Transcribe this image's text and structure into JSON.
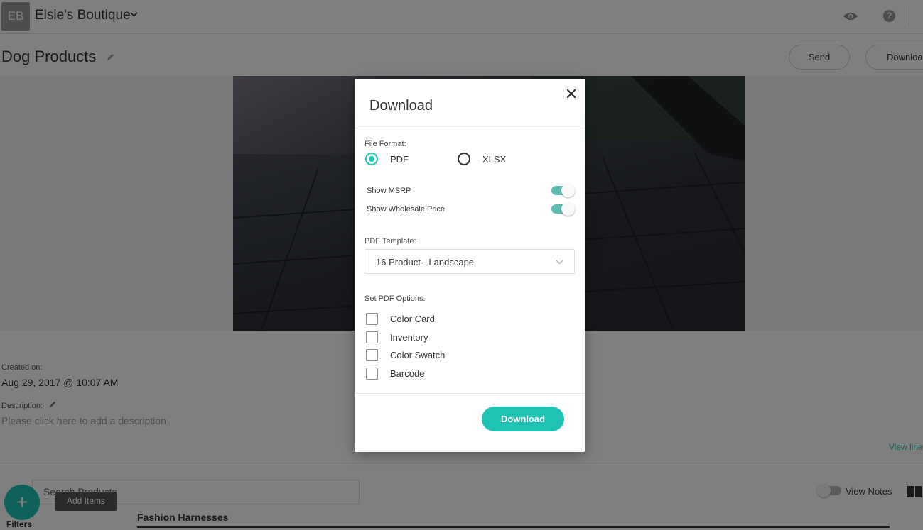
{
  "topbar": {
    "avatar_initials": "EB",
    "store_name": "Elsie's Boutique"
  },
  "page": {
    "title": "Dog Products",
    "send_label": "Send",
    "download_label": "Download"
  },
  "meta": {
    "created_label": "Created on:",
    "created_value": "Aug 29, 2017 @ 10:07 AM",
    "description_label": "Description:",
    "description_placeholder": "Please click here to add a description",
    "view_link": "View line"
  },
  "products": {
    "search_placeholder": "Search Products",
    "add_items_tooltip": "Add Items",
    "add_glyph": "+",
    "filters_label": "Filters",
    "view_notes_label": "View Notes",
    "section_title": "Fashion Harnesses"
  },
  "modal": {
    "title": "Download",
    "file_format_label": "File Format:",
    "formats": [
      {
        "label": "PDF",
        "checked": true
      },
      {
        "label": "XLSX",
        "checked": false
      }
    ],
    "toggles": [
      {
        "label": "Show MSRP",
        "on": true
      },
      {
        "label": "Show Wholesale Price",
        "on": true
      }
    ],
    "template_label": "PDF Template:",
    "template_value": "16 Product - Landscape",
    "options_label": "Set PDF Options:",
    "options": [
      {
        "label": "Color Card",
        "checked": false
      },
      {
        "label": "Inventory",
        "checked": false
      },
      {
        "label": "Color Swatch",
        "checked": false
      },
      {
        "label": "Barcode",
        "checked": false
      }
    ],
    "download_button": "Download"
  },
  "colors": {
    "accent": "#1fc3b6",
    "toggle_on": "#5fbcb4",
    "overlay": "rgba(0,0,0,0.5)"
  },
  "icons": {
    "close": "close-icon",
    "eye": "eye-icon",
    "help": "help-icon",
    "pencil": "pencil-icon",
    "caret": "chevron-down-icon"
  }
}
